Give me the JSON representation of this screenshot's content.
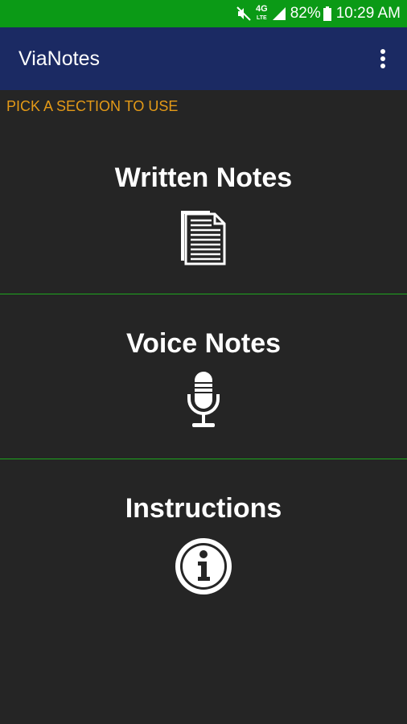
{
  "status_bar": {
    "network": "4G",
    "network_sub": "LTE",
    "battery": "82%",
    "time": "10:29 AM"
  },
  "app_bar": {
    "title": "ViaNotes",
    "menu_icon": "more-vert-icon"
  },
  "instruction": "PICK A SECTION TO USE",
  "sections": [
    {
      "label": "Written Notes",
      "icon": "document-icon"
    },
    {
      "label": "Voice Notes",
      "icon": "microphone-icon"
    },
    {
      "label": "Instructions",
      "icon": "info-icon"
    }
  ],
  "colors": {
    "status_bar": "#0b9a16",
    "app_bar": "#1b2a63",
    "background": "#252525",
    "accent_text": "#e49a17",
    "divider": "#1ea61e"
  }
}
